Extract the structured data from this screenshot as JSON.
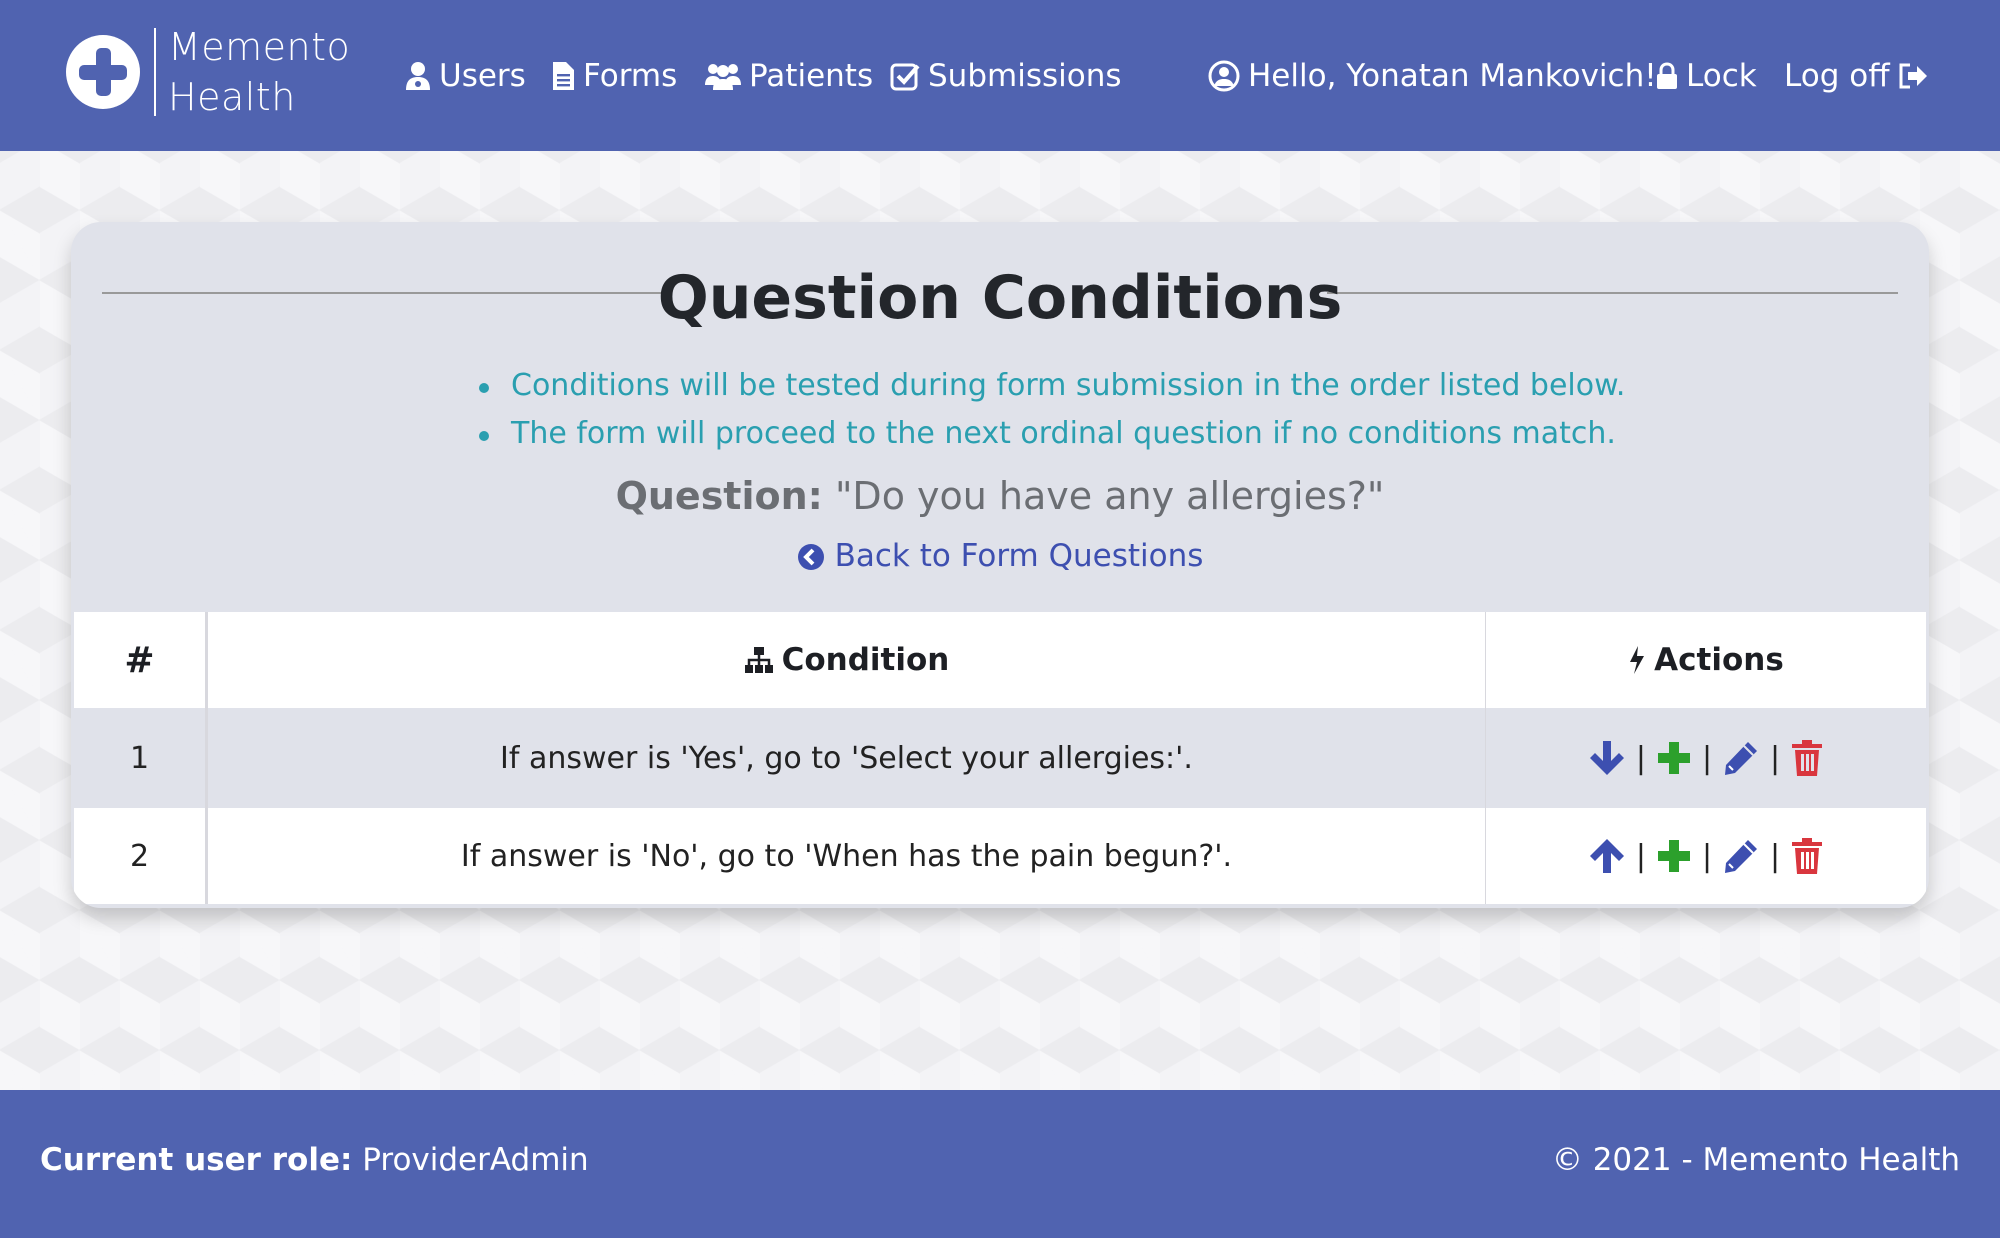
{
  "brand": {
    "name_line1": "Memento",
    "name_line2": "Health"
  },
  "nav": {
    "users": "Users",
    "forms": "Forms",
    "patients": "Patients",
    "submissions": "Submissions",
    "hello": "Hello, Yonatan Mankovich!",
    "lock": "Lock",
    "logoff": "Log off"
  },
  "page": {
    "title": "Question Conditions",
    "notes": [
      "Conditions will be tested during form submission in the order listed below.",
      "The form will proceed to the next ordinal question if no conditions match."
    ],
    "question_label": "Question:",
    "question_text": "\"Do you have any allergies?\"",
    "back_link": "Back to Form Questions"
  },
  "table": {
    "headers": {
      "num": "#",
      "condition": "Condition",
      "actions": "Actions"
    },
    "rows": [
      {
        "num": "1",
        "condition": "If answer is 'Yes', go to 'Select your allergies:'.",
        "move": "down"
      },
      {
        "num": "2",
        "condition": "If answer is 'No', go to 'When has the pain begun?'.",
        "move": "up"
      }
    ],
    "separator": "|"
  },
  "footer": {
    "role_label": "Current user role:",
    "role_value": "ProviderAdmin",
    "copyright": "© 2021 - Memento Health"
  },
  "colors": {
    "brand": "#5063b0",
    "note_text": "#2a9fb0",
    "link": "#3d4fb0",
    "add": "#2ca02c",
    "delete": "#d9363e"
  }
}
